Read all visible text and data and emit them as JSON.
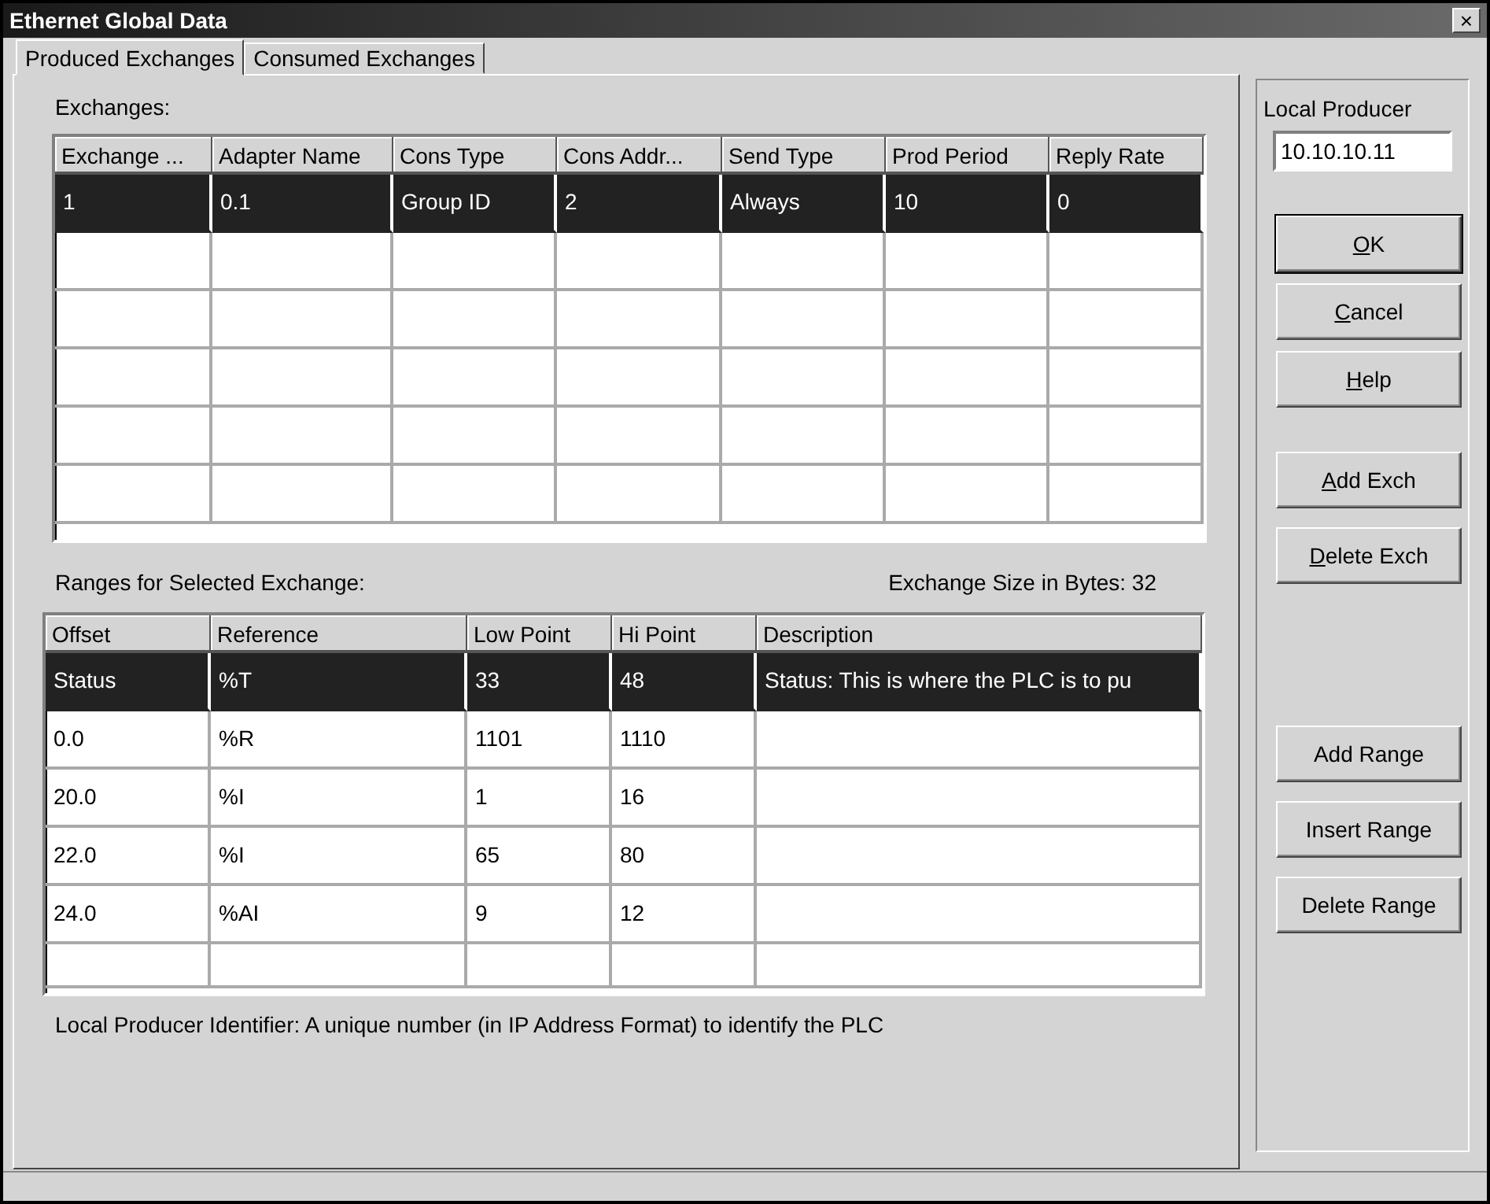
{
  "window": {
    "title": "Ethernet Global Data",
    "close": "×"
  },
  "tabs": [
    {
      "label": "Produced Exchanges",
      "selected": true
    },
    {
      "label": "Consumed Exchanges",
      "selected": false
    }
  ],
  "exchanges": {
    "label": "Exchanges:",
    "columns": [
      "Exchange ...",
      "Adapter Name",
      "Cons Type",
      "Cons Addr...",
      "Send Type",
      "Prod Period",
      "Reply Rate"
    ],
    "rows": [
      {
        "cells": [
          "1",
          "0.1",
          "Group ID",
          "2",
          "Always",
          "10",
          "0"
        ],
        "selected": true
      }
    ]
  },
  "ranges": {
    "label": "Ranges for Selected Exchange:",
    "size": "Exchange Size in Bytes: 32",
    "columns": [
      "Offset",
      "Reference",
      "Low Point",
      "Hi Point",
      "Description"
    ],
    "rows": [
      {
        "cells": [
          "Status",
          "%T",
          "33",
          "48",
          "Status: This is where the PLC is to pu"
        ],
        "selected": true
      },
      {
        "cells": [
          "0.0",
          "%R",
          "1101",
          "1110",
          ""
        ],
        "selected": false
      },
      {
        "cells": [
          "20.0",
          "%I",
          "1",
          "16",
          ""
        ],
        "selected": false
      },
      {
        "cells": [
          "22.0",
          "%I",
          "65",
          "80",
          ""
        ],
        "selected": false
      },
      {
        "cells": [
          "24.0",
          "%AI",
          "9",
          "12",
          ""
        ],
        "selected": false
      }
    ]
  },
  "hint": "Local Producer Identifier: A unique number (in IP Address Format) to identify the PLC",
  "local_producer": {
    "label": "Local Producer",
    "value": "10.10.10.11"
  },
  "dialog_buttons": [
    {
      "accel": "O",
      "rest": "K",
      "default": true
    },
    {
      "accel": "C",
      "rest": "ancel",
      "default": false
    },
    {
      "accel": "H",
      "rest": "elp",
      "default": false
    }
  ],
  "exchange_buttons": [
    {
      "accel": "A",
      "rest": "dd Exch",
      "default": false
    },
    {
      "accel": "D",
      "rest": "elete Exch",
      "default": false
    }
  ],
  "range_buttons": [
    {
      "rest": "Add Range",
      "default": false
    },
    {
      "rest": "Insert Range",
      "default": false
    },
    {
      "rest": "Delete Range",
      "default": false
    }
  ]
}
